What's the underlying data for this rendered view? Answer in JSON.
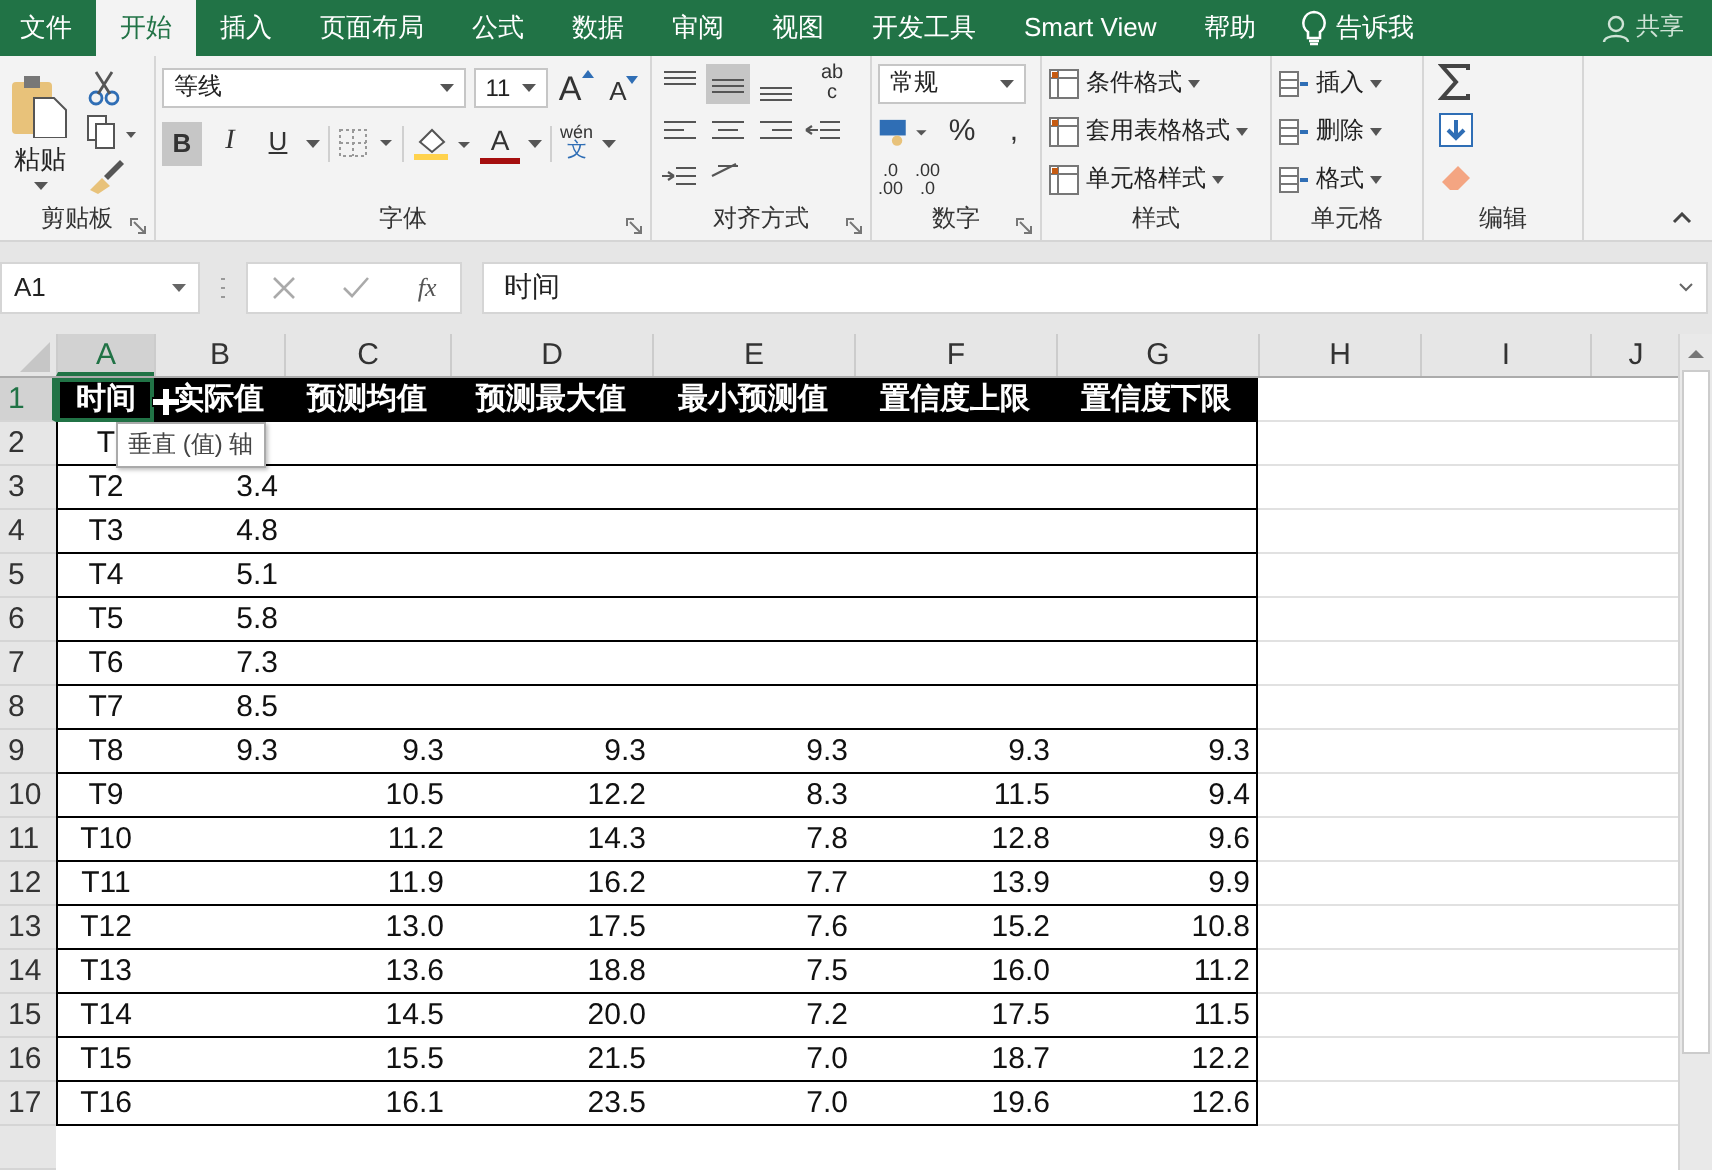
{
  "tabs": [
    {
      "label": "文件",
      "selected": false
    },
    {
      "label": "开始",
      "selected": true
    },
    {
      "label": "插入",
      "selected": false
    },
    {
      "label": "页面布局",
      "selected": false
    },
    {
      "label": "公式",
      "selected": false
    },
    {
      "label": "数据",
      "selected": false
    },
    {
      "label": "审阅",
      "selected": false
    },
    {
      "label": "视图",
      "selected": false
    },
    {
      "label": "开发工具",
      "selected": false
    },
    {
      "label": "Smart View",
      "selected": false
    },
    {
      "label": "帮助",
      "selected": false
    }
  ],
  "tell_me": "告诉我",
  "share": "共享",
  "clipboard": {
    "paste": "粘贴",
    "label": "剪贴板"
  },
  "font": {
    "name": "等线",
    "size": "11",
    "bold": "B",
    "italic": "I",
    "underline": "U",
    "grow": "A",
    "shrink": "A",
    "font_color": "A",
    "phonetic_top": "wén",
    "phonetic_bottom": "文",
    "label": "字体",
    "bold_on": true
  },
  "alignment": {
    "label": "对齐方式",
    "wrap_top": "ab",
    "wrap_bottom": "c"
  },
  "number": {
    "format": "常规",
    "percent": "%",
    "comma": ",",
    "label": "数字",
    "inc_decimal": [
      ".0",
      ".00"
    ],
    "dec_decimal": [
      ".00",
      ".0"
    ]
  },
  "styles": {
    "items": [
      "条件格式",
      "套用表格格式",
      "单元格样式"
    ],
    "label": "样式"
  },
  "cells": {
    "items": [
      "插入",
      "删除",
      "格式"
    ],
    "label": "单元格"
  },
  "editing": {
    "label": "编辑"
  },
  "formula_bar": {
    "name_box": "A1",
    "fx": "fx",
    "value": "时间"
  },
  "columns": [
    {
      "letter": "A",
      "selected": true
    },
    {
      "letter": "B",
      "selected": false
    },
    {
      "letter": "C",
      "selected": false
    },
    {
      "letter": "D",
      "selected": false
    },
    {
      "letter": "E",
      "selected": false
    },
    {
      "letter": "F",
      "selected": false
    },
    {
      "letter": "G",
      "selected": false
    },
    {
      "letter": "H",
      "selected": false
    },
    {
      "letter": "I",
      "selected": false
    },
    {
      "letter": "J",
      "selected": false
    }
  ],
  "rows": [
    {
      "number": "1",
      "selected": true,
      "kind": "header",
      "cells": [
        "时间",
        "实际值",
        "预测均值",
        "预测最大值",
        "最小预测值",
        "置信度上限",
        "置信度下限"
      ]
    },
    {
      "number": "2",
      "selected": false,
      "kind": "data",
      "cells": [
        "T",
        "",
        "",
        "",
        "",
        "",
        ""
      ]
    },
    {
      "number": "3",
      "selected": false,
      "kind": "data",
      "cells": [
        "T2",
        "3.4",
        "",
        "",
        "",
        "",
        ""
      ]
    },
    {
      "number": "4",
      "selected": false,
      "kind": "data",
      "cells": [
        "T3",
        "4.8",
        "",
        "",
        "",
        "",
        ""
      ]
    },
    {
      "number": "5",
      "selected": false,
      "kind": "data",
      "cells": [
        "T4",
        "5.1",
        "",
        "",
        "",
        "",
        ""
      ]
    },
    {
      "number": "6",
      "selected": false,
      "kind": "data",
      "cells": [
        "T5",
        "5.8",
        "",
        "",
        "",
        "",
        ""
      ]
    },
    {
      "number": "7",
      "selected": false,
      "kind": "data",
      "cells": [
        "T6",
        "7.3",
        "",
        "",
        "",
        "",
        ""
      ]
    },
    {
      "number": "8",
      "selected": false,
      "kind": "data",
      "cells": [
        "T7",
        "8.5",
        "",
        "",
        "",
        "",
        ""
      ]
    },
    {
      "number": "9",
      "selected": false,
      "kind": "data",
      "cells": [
        "T8",
        "9.3",
        "9.3",
        "9.3",
        "9.3",
        "9.3",
        "9.3"
      ]
    },
    {
      "number": "10",
      "selected": false,
      "kind": "data",
      "cells": [
        "T9",
        "",
        "10.5",
        "12.2",
        "8.3",
        "11.5",
        "9.4"
      ]
    },
    {
      "number": "11",
      "selected": false,
      "kind": "data",
      "cells": [
        "T10",
        "",
        "11.2",
        "14.3",
        "7.8",
        "12.8",
        "9.6"
      ]
    },
    {
      "number": "12",
      "selected": false,
      "kind": "data",
      "cells": [
        "T11",
        "",
        "11.9",
        "16.2",
        "7.7",
        "13.9",
        "9.9"
      ]
    },
    {
      "number": "13",
      "selected": false,
      "kind": "data",
      "cells": [
        "T12",
        "",
        "13.0",
        "17.5",
        "7.6",
        "15.2",
        "10.8"
      ]
    },
    {
      "number": "14",
      "selected": false,
      "kind": "data",
      "cells": [
        "T13",
        "",
        "13.6",
        "18.8",
        "7.5",
        "16.0",
        "11.2"
      ]
    },
    {
      "number": "15",
      "selected": false,
      "kind": "data",
      "cells": [
        "T14",
        "",
        "14.5",
        "20.0",
        "7.2",
        "17.5",
        "11.5"
      ]
    },
    {
      "number": "16",
      "selected": false,
      "kind": "data",
      "cells": [
        "T15",
        "",
        "15.5",
        "21.5",
        "7.0",
        "18.7",
        "12.2"
      ]
    },
    {
      "number": "17",
      "selected": false,
      "kind": "data",
      "cells": [
        "T16",
        "",
        "16.1",
        "23.5",
        "7.0",
        "19.6",
        "12.6"
      ]
    }
  ],
  "tooltip": "垂直 (值) 轴"
}
